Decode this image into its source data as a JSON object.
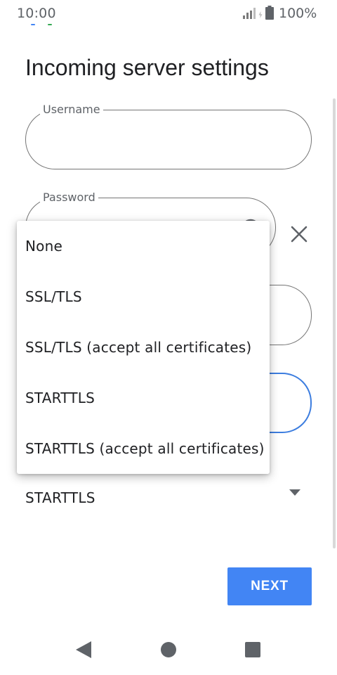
{
  "status_bar": {
    "time": "10:00",
    "battery_percent": "100%",
    "icons": [
      "signal-icon",
      "charging-icon",
      "battery-icon"
    ],
    "notification_dot_colors": [
      "#4285f4",
      "#34a853"
    ]
  },
  "page": {
    "title": "Incoming server settings"
  },
  "form": {
    "username": {
      "label": "Username",
      "value": ""
    },
    "password": {
      "label": "Password",
      "value": "",
      "toggle_icon": "visibility-toggle-icon",
      "clear_icon": "close-icon"
    },
    "server": {
      "value": ""
    },
    "port": {
      "value": "",
      "focused": true
    },
    "security": {
      "selected": "STARTTLS",
      "arrow_icon": "dropdown-arrow-icon"
    }
  },
  "security_menu": {
    "options": [
      "None",
      "SSL/TLS",
      "SSL/TLS (accept all certificates)",
      "STARTTLS",
      "STARTTLS (accept all certificates)"
    ]
  },
  "actions": {
    "next_label": "NEXT"
  },
  "nav_bar": {
    "icons": [
      "back-icon",
      "home-icon",
      "recents-icon"
    ]
  },
  "colors": {
    "accent": "#4285f4",
    "focus_outline": "#3c7ddf",
    "outline": "#757575",
    "text_primary": "#202124",
    "text_secondary": "#5f6368"
  }
}
